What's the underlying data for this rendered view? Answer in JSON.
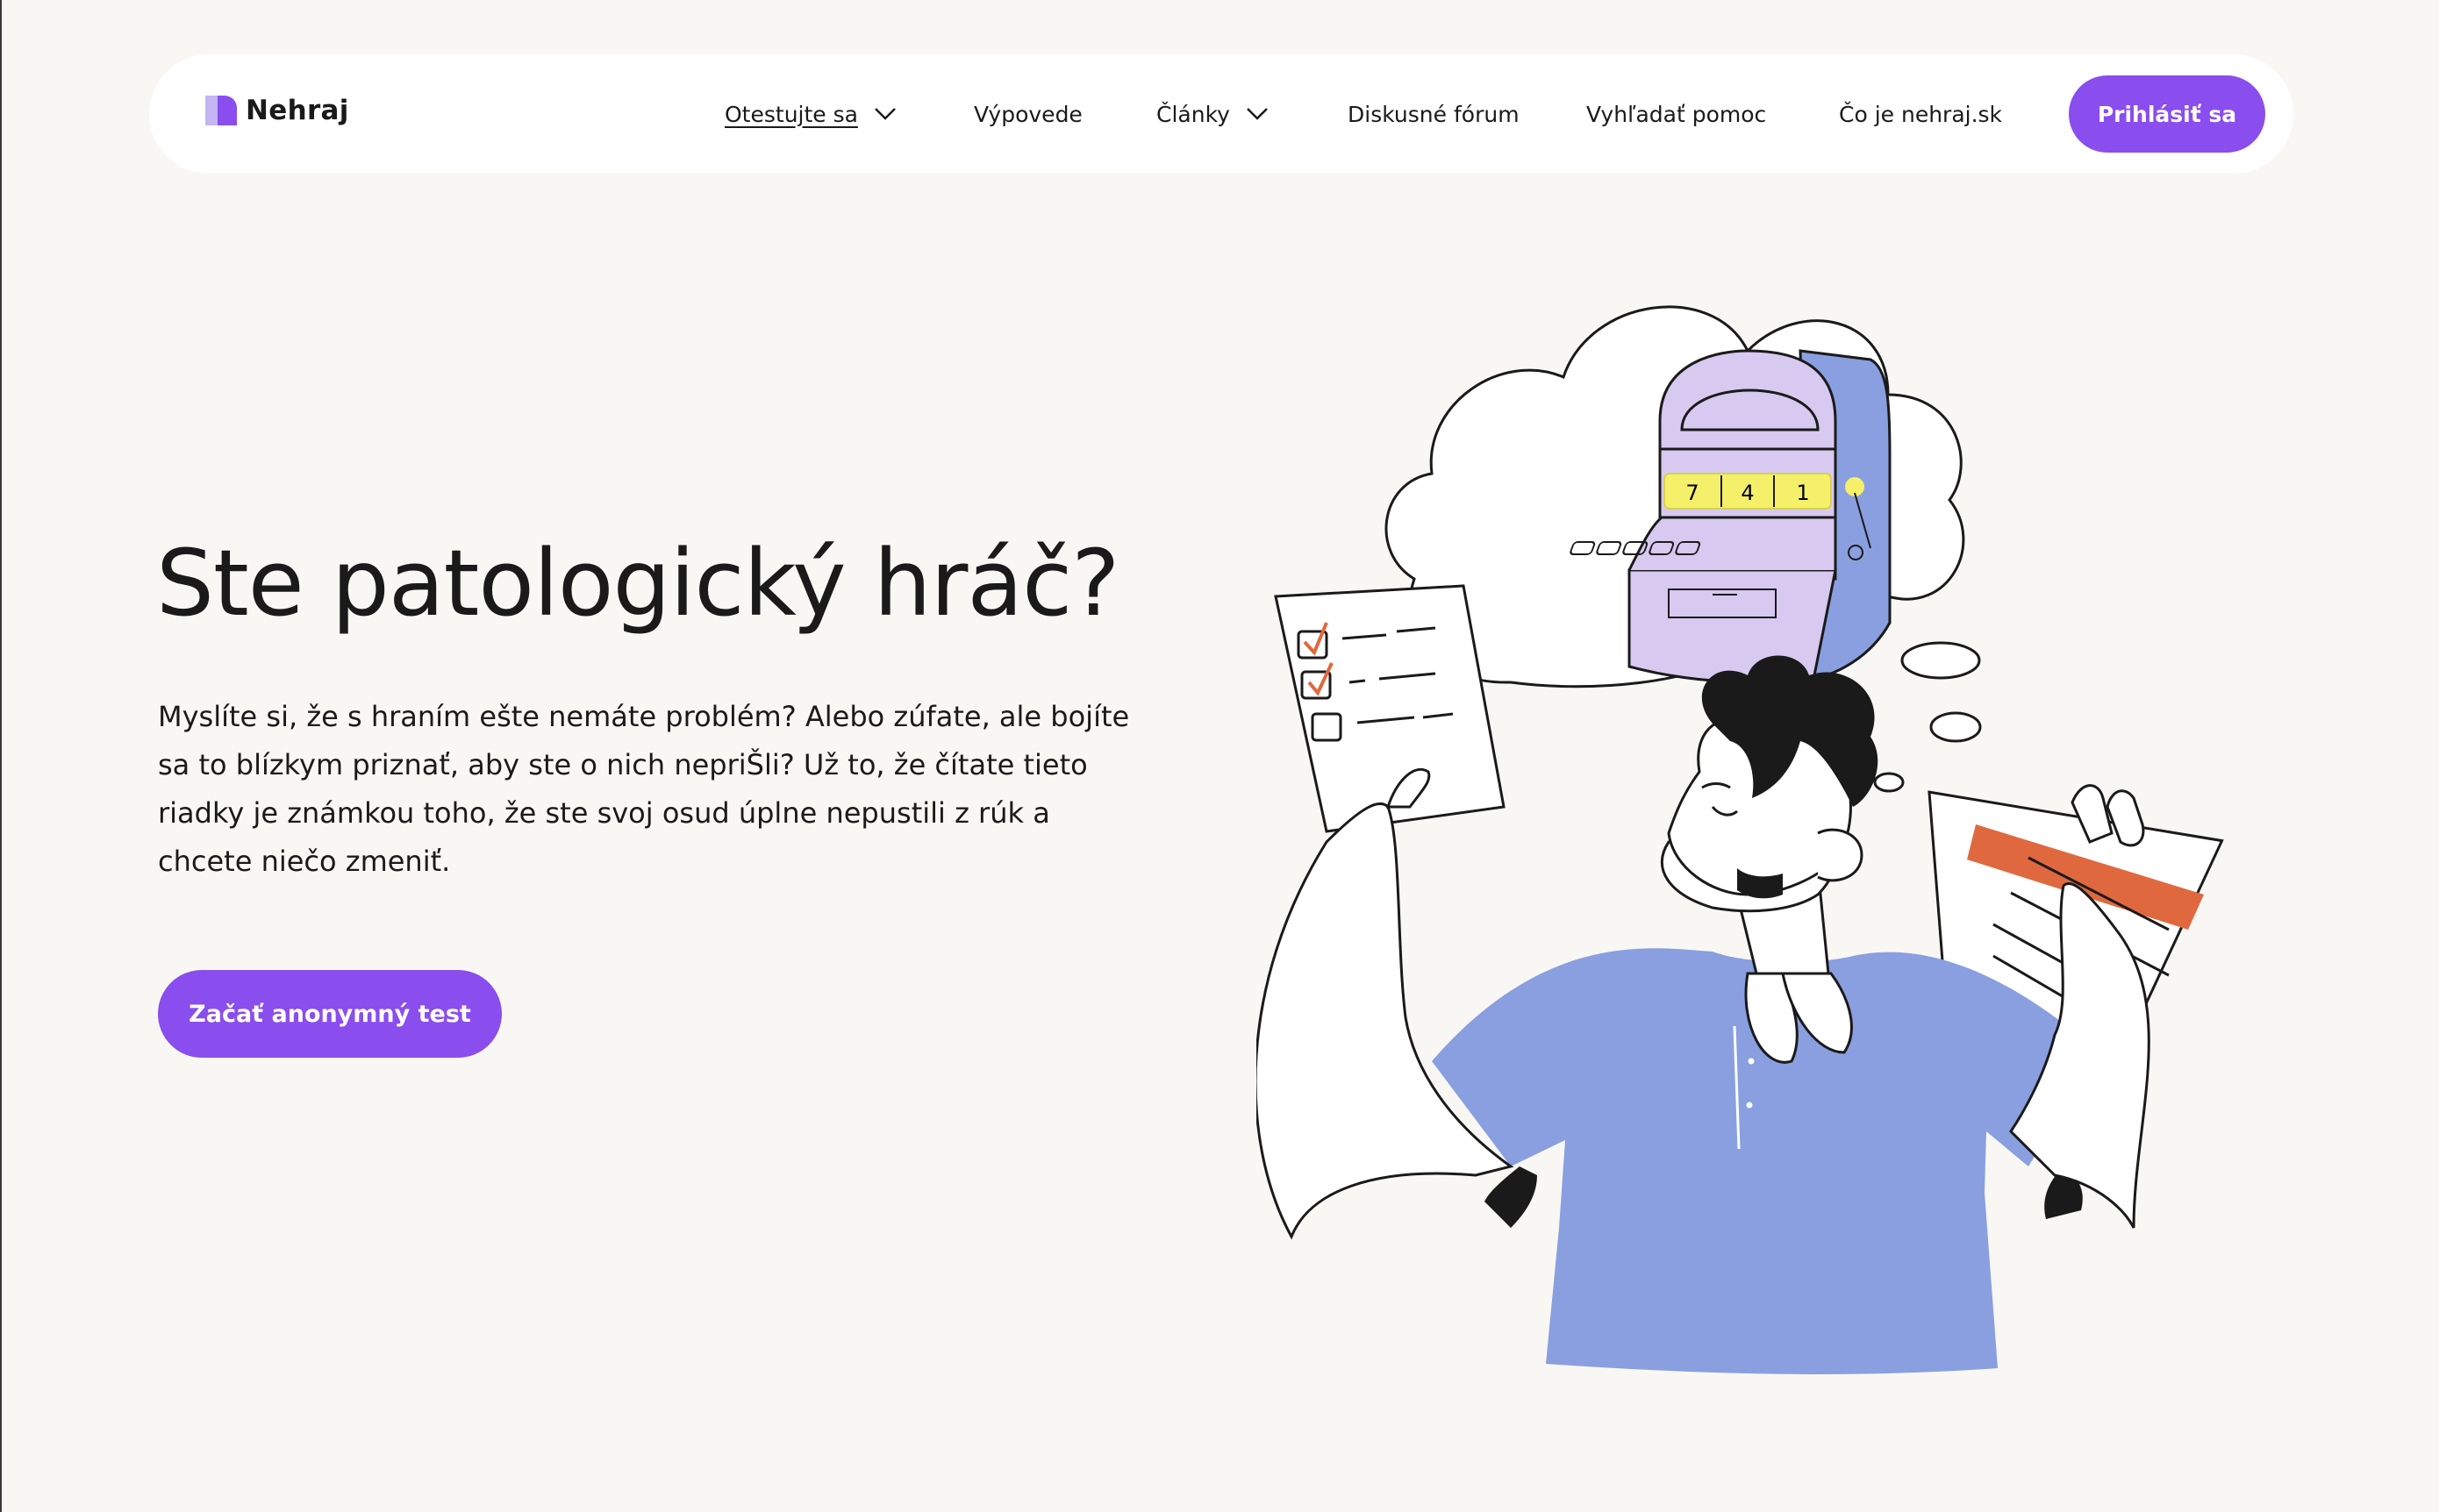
{
  "header": {
    "logo_text": "Nehraj",
    "nav": [
      {
        "label": "Otestujte sa",
        "has_dropdown": true,
        "active": true
      },
      {
        "label": "Výpovede",
        "has_dropdown": false
      },
      {
        "label": "Články",
        "has_dropdown": true
      },
      {
        "label": "Diskusné fórum",
        "has_dropdown": false
      },
      {
        "label": "Vyhľadať pomoc",
        "has_dropdown": false
      },
      {
        "label": "Čo je nehraj.sk",
        "has_dropdown": false
      }
    ],
    "login_label": "Prihlásiť sa"
  },
  "hero": {
    "title": "Ste patologický hráč?",
    "text": "Myslíte si, že s hraním ešte nemáte problém? Alebo zúfate, ale bojíte sa to blízkym priznať, aby ste o nich nepriŠli? Už to, že čítate tieto riadky je známkou toho, že ste svoj osud úplne nepustili z rúk a chcete niečo zmeniť.",
    "cta_label": "Začať anonymný test"
  },
  "illustration": {
    "slot_digits": [
      "7",
      "4",
      "1"
    ]
  },
  "colors": {
    "accent": "#8a4dee",
    "background": "#f8f7f4",
    "shirt": "#8a9fdf",
    "machine_light": "#d7c9f0",
    "machine_dark": "#8a9fdf",
    "slot_yellow": "#f5f06a",
    "paper_orange": "#e0683f"
  }
}
